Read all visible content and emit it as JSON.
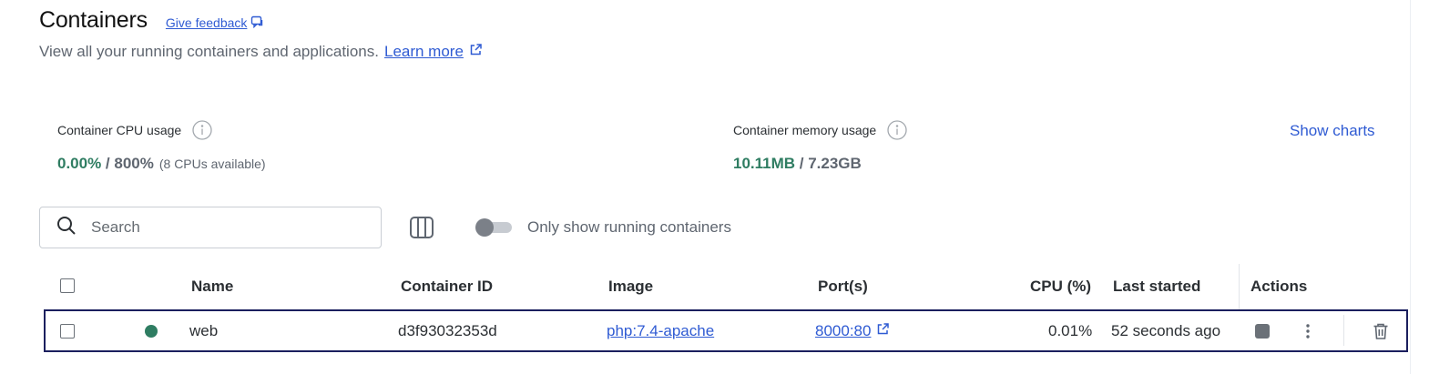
{
  "header": {
    "title": "Containers",
    "feedback_label": "Give feedback",
    "subtitle": "View all your running containers and applications.",
    "learn_more": "Learn more"
  },
  "stats": {
    "cpu": {
      "label": "Container CPU usage",
      "used": "0.00%",
      "separator": " / ",
      "total": "800%",
      "note": "(8 CPUs available)"
    },
    "memory": {
      "label": "Container memory usage",
      "used": "10.11MB",
      "separator": " / ",
      "total": "7.23GB"
    },
    "show_charts": "Show charts"
  },
  "toolbar": {
    "search_placeholder": "Search",
    "toggle_label": "Only show running containers",
    "toggle_on": false
  },
  "table": {
    "columns": {
      "name": "Name",
      "container_id": "Container ID",
      "image": "Image",
      "ports": "Port(s)",
      "cpu": "CPU (%)",
      "last_started": "Last started",
      "actions": "Actions"
    },
    "rows": [
      {
        "status": "running",
        "name": "web",
        "container_id": "d3f93032353d",
        "image": "php:7.4-apache",
        "ports": "8000:80",
        "cpu": "0.01%",
        "last_started": "52 seconds ago"
      }
    ]
  },
  "colors": {
    "accent": "#2f5bd3",
    "running": "#2f7d62",
    "selection_border": "#1b1f5e"
  },
  "icons": [
    "feedback-icon",
    "external-link-icon",
    "info-icon",
    "search-icon",
    "columns-icon",
    "stop-icon",
    "more-vertical-icon",
    "trash-icon"
  ]
}
